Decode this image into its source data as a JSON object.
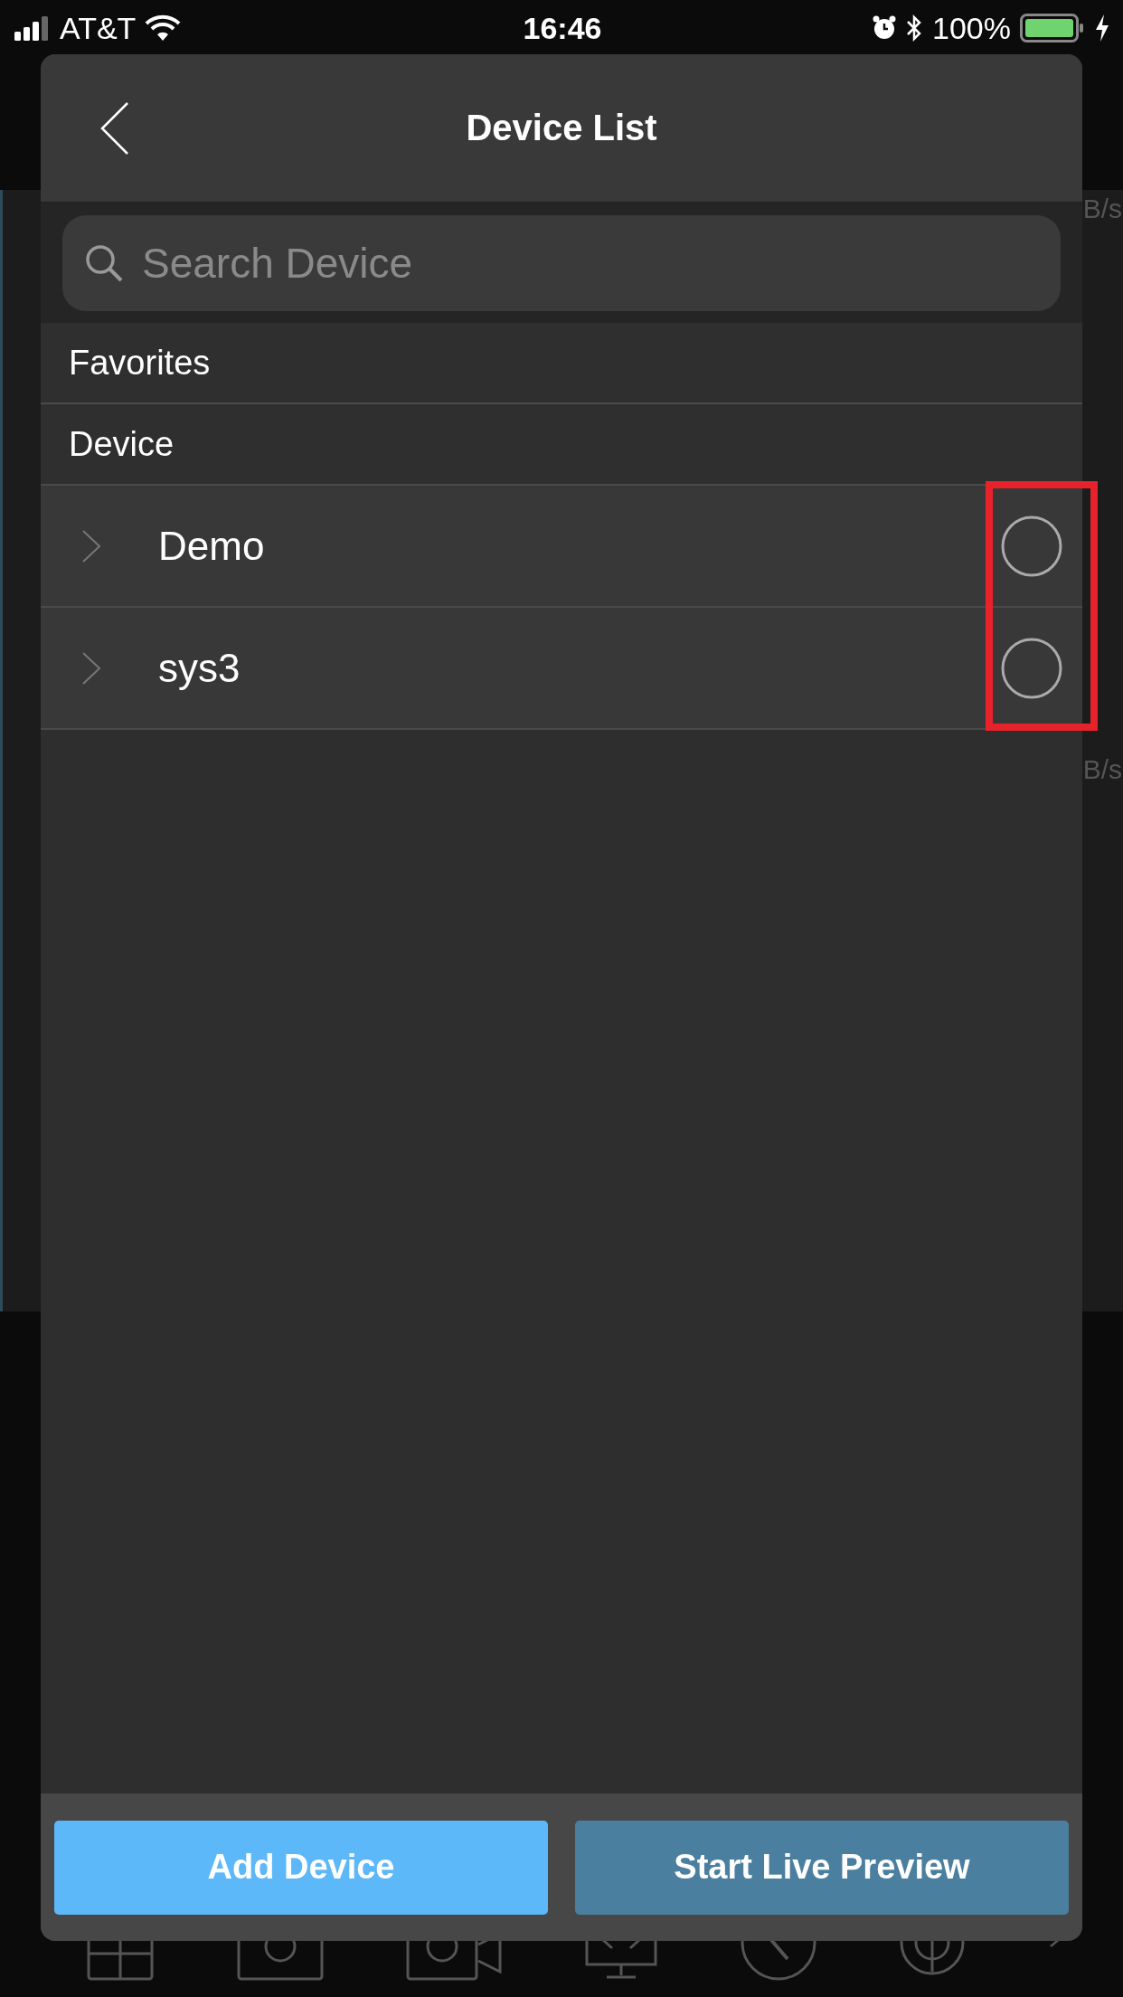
{
  "status_bar": {
    "carrier": "AT&T",
    "time": "16:46",
    "battery": "100%"
  },
  "background": {
    "speed_labels": [
      "B/s",
      "B/s"
    ]
  },
  "panel": {
    "title": "Device List",
    "search": {
      "placeholder": "Search Device"
    },
    "sections": [
      "Favorites",
      "Device"
    ],
    "devices": [
      {
        "name": "Demo",
        "expanded": false,
        "selected": false
      },
      {
        "name": "sys3",
        "expanded": false,
        "selected": false
      }
    ],
    "buttons": [
      {
        "label": "Add Device",
        "kind": "primary"
      },
      {
        "label": "Start Live Preview",
        "kind": "secondary"
      }
    ]
  }
}
